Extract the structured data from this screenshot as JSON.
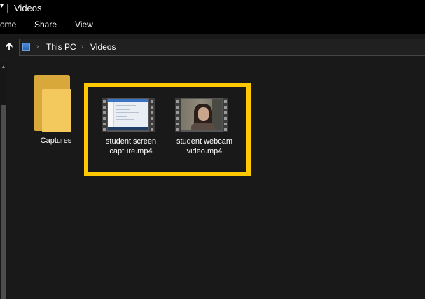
{
  "window": {
    "title": "Videos"
  },
  "ribbon": {
    "tabs": [
      "ome",
      "Share",
      "View"
    ]
  },
  "address": {
    "crumbs": [
      "This PC",
      "Videos"
    ]
  },
  "items": [
    {
      "label": "Captures",
      "type": "folder"
    },
    {
      "label": "student screen capture.mp4",
      "type": "video"
    },
    {
      "label": "student webcam video.mp4",
      "type": "video"
    }
  ],
  "colors": {
    "highlight": "#ffc800",
    "background": "#191919",
    "folder": "#f3c95e"
  },
  "icons": {
    "up": "up-arrow-icon",
    "pc": "this-pc-icon",
    "folder": "folder-icon",
    "video": "video-thumbnail-icon"
  }
}
